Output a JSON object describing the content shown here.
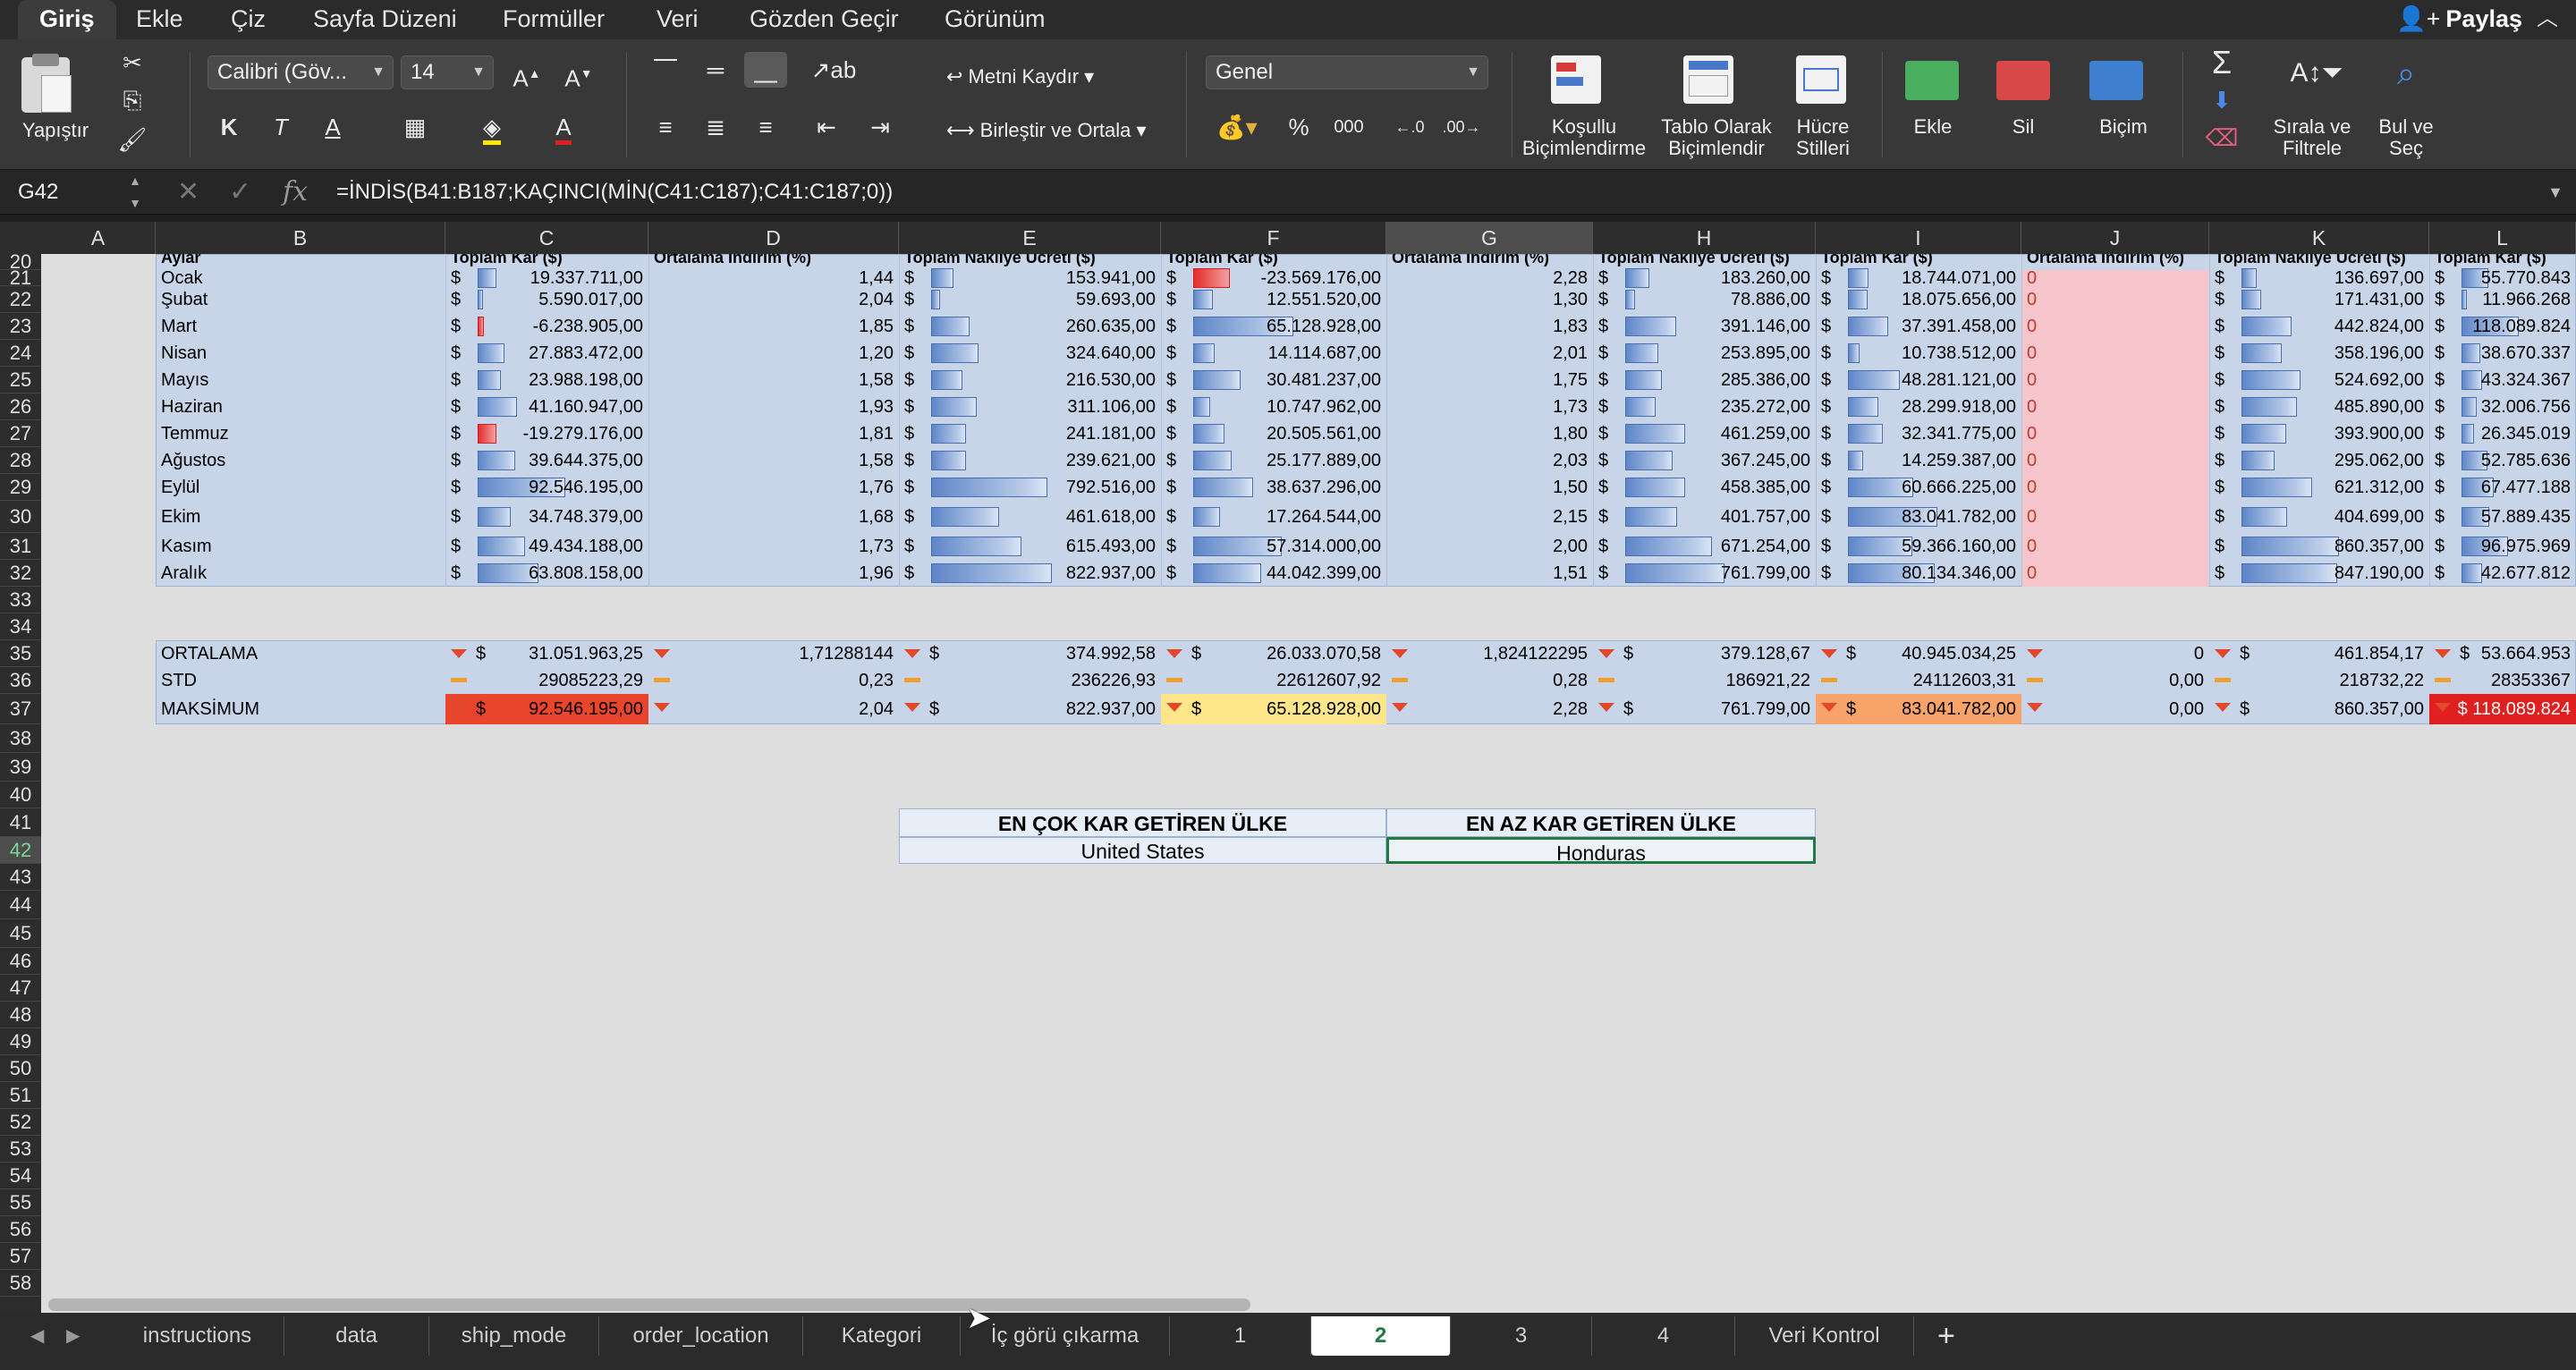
{
  "ribbon_tabs": [
    "Giriş",
    "Ekle",
    "Çiz",
    "Sayfa Düzeni",
    "Formüller",
    "Veri",
    "Gözden Geçir",
    "Görünüm"
  ],
  "share_label": "Paylaş",
  "ribbon": {
    "paste": "Yapıştır",
    "font_name": "Calibri (Göv...",
    "font_size": "14",
    "bold": "K",
    "italic": "T",
    "underline": "A",
    "wrap_text": "Metni Kaydır",
    "merge_center": "Birleştir ve Ortala",
    "number_format": "Genel",
    "percent": "%",
    "thousands": "000",
    "cond_format": [
      "Koşullu",
      "Biçimlendirme"
    ],
    "format_table": [
      "Tablo Olarak",
      "Biçimlendir"
    ],
    "cell_styles": [
      "Hücre",
      "Stilleri"
    ],
    "insert": "Ekle",
    "delete": "Sil",
    "format": "Biçim",
    "sort_filter": [
      "Sırala ve",
      "Filtrele"
    ],
    "find_select": [
      "Bul ve",
      "Seç"
    ]
  },
  "name_box": "G42",
  "formula": "=İNDİS(B41:B187;KAÇINCI(MİN(C41:C187);C41:C187;0))",
  "columns": [
    "A",
    "B",
    "C",
    "D",
    "E",
    "F",
    "G",
    "H",
    "I",
    "J",
    "K",
    "L"
  ],
  "selected_column": "G",
  "rows": [
    "20",
    "21",
    "22",
    "23",
    "24",
    "25",
    "26",
    "27",
    "28",
    "29",
    "30",
    "31",
    "32",
    "33",
    "34",
    "35",
    "36",
    "37",
    "38",
    "39",
    "40",
    "41",
    "42",
    "43",
    "44",
    "45",
    "46",
    "47",
    "48",
    "49",
    "50",
    "51",
    "52",
    "53",
    "54",
    "55",
    "56",
    "57",
    "58"
  ],
  "selected_row": "42",
  "header_row_partial": [
    "Aylar",
    "Toplam Kar ($)",
    "Ortalama İndirim (%)",
    "Toplam Nakliye Ücreti ($)",
    "Toplam Kar ($)",
    "Ortalama İndirim (%)",
    "Toplam Nakliye Ücreti ($)",
    "Toplam Kar ($)",
    "Ortalama İndirim (%)",
    "Toplam Nakliye Ücreti ($)",
    "Toplam Kar ($)"
  ],
  "months": [
    {
      "name": "Ocak",
      "c": "19.337.711,00",
      "d": "1,44",
      "e": "153.941,00",
      "f": "-23.569.176,00",
      "g": "2,28",
      "h": "183.260,00",
      "i": "18.744.071,00",
      "j": "0",
      "k": "136.697,00",
      "l": "55.770.843"
    },
    {
      "name": "Şubat",
      "c": "5.590.017,00",
      "d": "2,04",
      "e": "59.693,00",
      "f": "12.551.520,00",
      "g": "1,30",
      "h": "78.886,00",
      "i": "18.075.656,00",
      "j": "0",
      "k": "171.431,00",
      "l": "11.966.268"
    },
    {
      "name": "Mart",
      "c": "-6.238.905,00",
      "d": "1,85",
      "e": "260.635,00",
      "f": "65.128.928,00",
      "g": "1,83",
      "h": "391.146,00",
      "i": "37.391.458,00",
      "j": "0",
      "k": "442.824,00",
      "l": "118.089.824"
    },
    {
      "name": "Nisan",
      "c": "27.883.472,00",
      "d": "1,20",
      "e": "324.640,00",
      "f": "14.114.687,00",
      "g": "2,01",
      "h": "253.895,00",
      "i": "10.738.512,00",
      "j": "0",
      "k": "358.196,00",
      "l": "38.670.337"
    },
    {
      "name": "Mayıs",
      "c": "23.988.198,00",
      "d": "1,58",
      "e": "216.530,00",
      "f": "30.481.237,00",
      "g": "1,75",
      "h": "285.386,00",
      "i": "48.281.121,00",
      "j": "0",
      "k": "524.692,00",
      "l": "43.324.367"
    },
    {
      "name": "Haziran",
      "c": "41.160.947,00",
      "d": "1,93",
      "e": "311.106,00",
      "f": "10.747.962,00",
      "g": "1,73",
      "h": "235.272,00",
      "i": "28.299.918,00",
      "j": "0",
      "k": "485.890,00",
      "l": "32.006.756"
    },
    {
      "name": "Temmuz",
      "c": "-19.279.176,00",
      "d": "1,81",
      "e": "241.181,00",
      "f": "20.505.561,00",
      "g": "1,80",
      "h": "461.259,00",
      "i": "32.341.775,00",
      "j": "0",
      "k": "393.900,00",
      "l": "26.345.019"
    },
    {
      "name": "Ağustos",
      "c": "39.644.375,00",
      "d": "1,58",
      "e": "239.621,00",
      "f": "25.177.889,00",
      "g": "2,03",
      "h": "367.245,00",
      "i": "14.259.387,00",
      "j": "0",
      "k": "295.062,00",
      "l": "52.785.636"
    },
    {
      "name": "Eylül",
      "c": "92.546.195,00",
      "d": "1,76",
      "e": "792.516,00",
      "f": "38.637.296,00",
      "g": "1,50",
      "h": "458.385,00",
      "i": "60.666.225,00",
      "j": "0",
      "k": "621.312,00",
      "l": "67.477.188"
    },
    {
      "name": "Ekim",
      "c": "34.748.379,00",
      "d": "1,68",
      "e": "461.618,00",
      "f": "17.264.544,00",
      "g": "2,15",
      "h": "401.757,00",
      "i": "83.041.782,00",
      "j": "0",
      "k": "404.699,00",
      "l": "57.889.435"
    },
    {
      "name": "Kasım",
      "c": "49.434.188,00",
      "d": "1,73",
      "e": "615.493,00",
      "f": "57.314.000,00",
      "g": "2,00",
      "h": "671.254,00",
      "i": "59.366.160,00",
      "j": "0",
      "k": "860.357,00",
      "l": "96.975.969"
    },
    {
      "name": "Aralık",
      "c": "63.808.158,00",
      "d": "1,96",
      "e": "822.937,00",
      "f": "44.042.399,00",
      "g": "1,51",
      "h": "761.799,00",
      "i": "80.134.346,00",
      "j": "0",
      "k": "847.190,00",
      "l": "42.677.812"
    }
  ],
  "stats": [
    {
      "label": "ORTALAMA",
      "c": "31.051.963,25",
      "d": "1,71288144",
      "e": "374.992,58",
      "f": "26.033.070,58",
      "g": "1,824122295",
      "h": "379.128,67",
      "i": "40.945.034,25",
      "j": "0",
      "k": "461.854,17",
      "l": "53.664.953"
    },
    {
      "label": "STD",
      "c": "29085223,29",
      "d": "0,23",
      "e": "236226,93",
      "f": "22612607,92",
      "g": "0,28",
      "h": "186921,22",
      "i": "24112603,31",
      "j": "0,00",
      "k": "218732,22",
      "l": "28353367"
    },
    {
      "label": "MAKSİMUM",
      "c": "92.546.195,00",
      "d": "2,04",
      "e": "822.937,00",
      "f": "65.128.928,00",
      "g": "2,28",
      "h": "761.799,00",
      "i": "83.041.782,00",
      "j": "0,00",
      "k": "860.357,00",
      "l": "$ 118.089.824"
    }
  ],
  "summary": {
    "most_label": "EN ÇOK KAR GETİREN ÜLKE",
    "least_label": "EN AZ KAR GETİREN ÜLKE",
    "most_value": "United States",
    "least_value": "Honduras"
  },
  "sheet_tabs": [
    "instructions",
    "data",
    "ship_mode",
    "order_location",
    "Kategori",
    "İç görü çıkarma",
    "1",
    "2",
    "3",
    "4",
    "Veri Kontrol"
  ],
  "active_sheet": "2",
  "currency_symbol": "$",
  "colors": {
    "accent_green": "#1f7a46",
    "max_red": "#e8452c",
    "max_yellow": "#ffe68a",
    "max_orange": "#f7a36a"
  }
}
